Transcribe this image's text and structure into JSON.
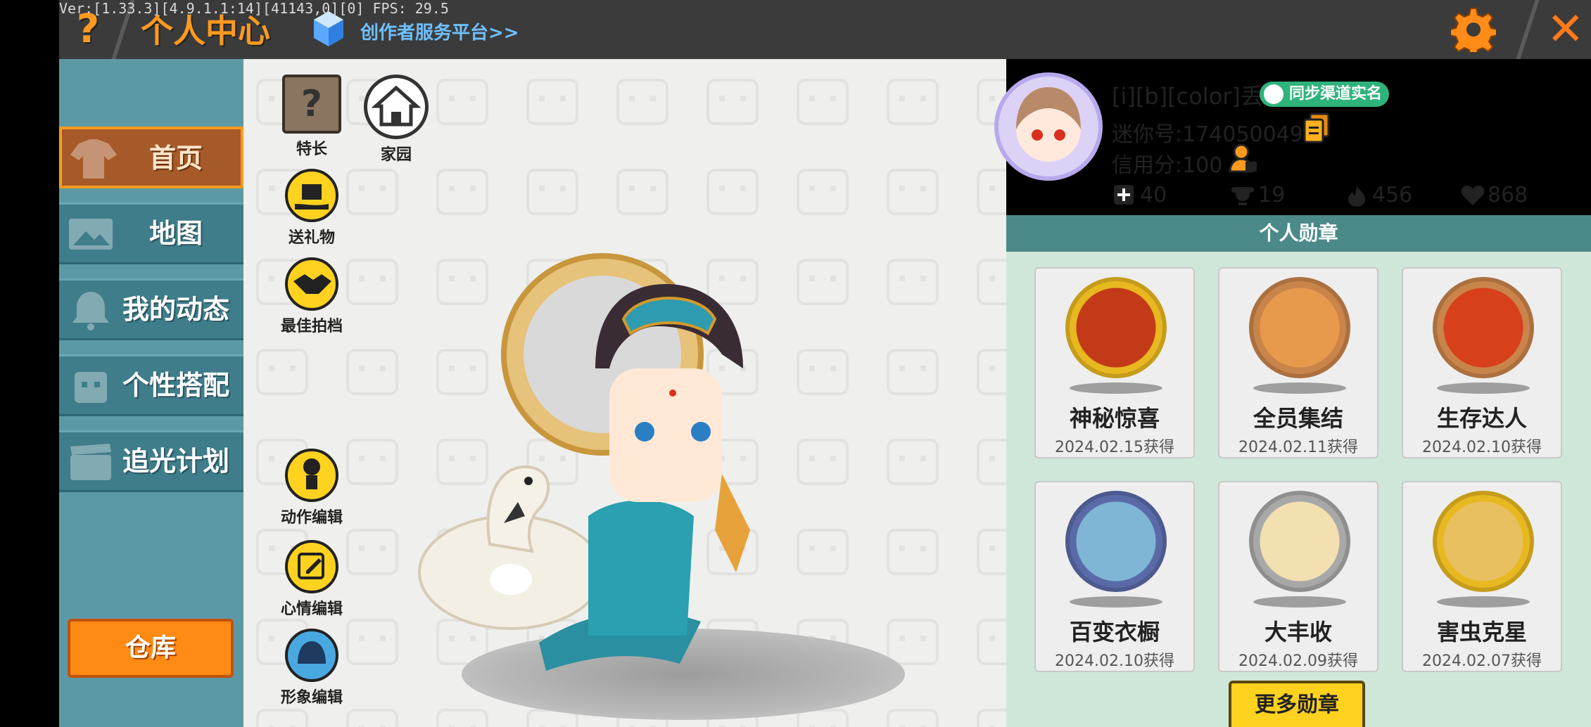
{
  "debug_text": "Ver:[1.33.3][4.9.1.1:14][41143,0][0] FPS: 29.5",
  "header": {
    "help_glyph": "?",
    "title": "个人中心",
    "creator_link": "创作者服务平台>>",
    "close_glyph": "✕"
  },
  "sidebar": {
    "items": [
      {
        "label": "首页",
        "icon": "shirt-icon",
        "active": true
      },
      {
        "label": "地图",
        "icon": "map-icon",
        "active": false
      },
      {
        "label": "我的动态",
        "icon": "bell-icon",
        "active": false
      },
      {
        "label": "个性搭配",
        "icon": "avatar-outfit-icon",
        "active": false
      },
      {
        "label": "追光计划",
        "icon": "clapperboard-icon",
        "active": false
      }
    ],
    "warehouse_label": "仓库"
  },
  "stage": {
    "actions": [
      {
        "label": "特长",
        "icon": "question-box-icon"
      },
      {
        "label": "家园",
        "icon": "house-icon"
      },
      {
        "label": "送礼物",
        "icon": "gift-hand-icon"
      },
      {
        "label": "最佳拍档",
        "icon": "handshake-icon"
      },
      {
        "label": "动作编辑",
        "icon": "pose-icon"
      },
      {
        "label": "心情编辑",
        "icon": "edit-pencil-icon"
      },
      {
        "label": "形象编辑",
        "icon": "character-head-icon"
      }
    ]
  },
  "profile": {
    "username": "[i][b][color]丢.",
    "sync_label": "同步渠道实名",
    "mini_id": "迷你号:1740500491",
    "credit": "信用分:100",
    "stats": [
      {
        "icon": "plus-box-icon",
        "value": "40"
      },
      {
        "icon": "trophy-icon",
        "value": "19"
      },
      {
        "icon": "flame-icon",
        "value": "456"
      },
      {
        "icon": "heart-icon",
        "value": "868"
      }
    ]
  },
  "medals": {
    "title": "个人勋章",
    "items": [
      {
        "name": "神秘惊喜",
        "date": "2024.02.15获得",
        "rim": "#e8b820",
        "core": "#c33a18"
      },
      {
        "name": "全员集结",
        "date": "2024.02.11获得",
        "rim": "#c9844a",
        "core": "#e79a4c"
      },
      {
        "name": "生存达人",
        "date": "2024.02.10获得",
        "rim": "#c9844a",
        "core": "#d8401c"
      },
      {
        "name": "百变衣橱",
        "date": "2024.02.10获得",
        "rim": "#5a6aa8",
        "core": "#7fb6d6"
      },
      {
        "name": "大丰收",
        "date": "2024.02.09获得",
        "rim": "#a8a8a8",
        "core": "#f3e0b0"
      },
      {
        "name": "害虫克星",
        "date": "2024.02.07获得",
        "rim": "#e8b820",
        "core": "#e8c060"
      }
    ],
    "more_label": "更多勋章"
  }
}
